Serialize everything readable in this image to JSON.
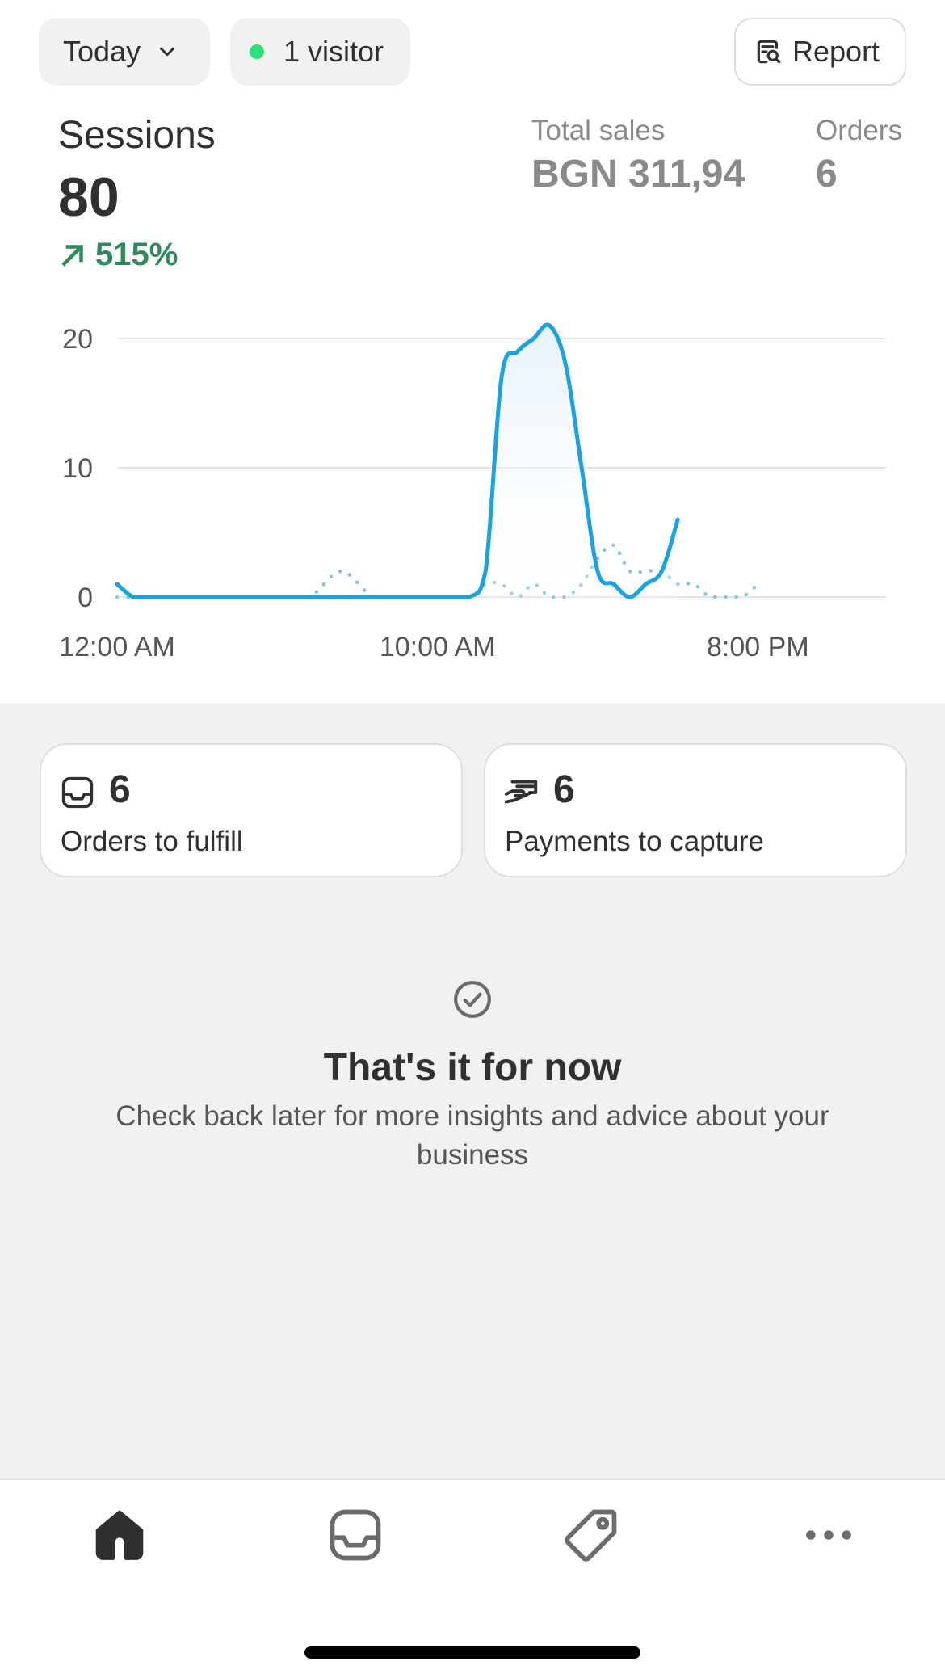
{
  "filters": {
    "date_range": "Today",
    "visitors": "1 visitor",
    "report_label": "Report"
  },
  "metrics": {
    "sessions": {
      "label": "Sessions",
      "value": "80",
      "change": "515%"
    },
    "total_sales": {
      "label": "Total sales",
      "value": "BGN 311,94"
    },
    "orders": {
      "label": "Orders",
      "value": "6"
    }
  },
  "chart_data": {
    "type": "line",
    "title": "",
    "xlabel": "",
    "ylabel": "",
    "ylim": [
      0,
      20
    ],
    "y_ticks": [
      "0",
      "10",
      "20"
    ],
    "x_tick_labels": [
      "12:00 AM",
      "10:00 AM",
      "8:00 PM"
    ],
    "grid": true,
    "x_hours": [
      0,
      0.5,
      1,
      2,
      3,
      4,
      5,
      6,
      7,
      8,
      9,
      10,
      11,
      11.5,
      12,
      12.5,
      13,
      13.5,
      14,
      14.5,
      15,
      15.5,
      16,
      16.5,
      17,
      17.5,
      18,
      18.5,
      19,
      19.5,
      20
    ],
    "series": [
      {
        "name": "",
        "style": "solid",
        "color": "#1aa3e0",
        "values": [
          1,
          0,
          0,
          0,
          0,
          0,
          0,
          0,
          0,
          0,
          0,
          0,
          0,
          2,
          17,
          19,
          20,
          21,
          18,
          10,
          2,
          1,
          0,
          1,
          2,
          6,
          null,
          null,
          null,
          null,
          null
        ]
      },
      {
        "name": "",
        "style": "dotted",
        "color": "#7cc6e8",
        "values": [
          0,
          0,
          0,
          0,
          0,
          0,
          0,
          0,
          2,
          0,
          0,
          0,
          0,
          1,
          1,
          0,
          1,
          0,
          0,
          1,
          3,
          4,
          2,
          2,
          2,
          1,
          1,
          0,
          0,
          0,
          1
        ]
      }
    ]
  },
  "tasks": {
    "orders_to_fulfill": {
      "count": "6",
      "label": "Orders to fulfill"
    },
    "payments_to_capture": {
      "count": "6",
      "label": "Payments to capture"
    }
  },
  "empty_state": {
    "title": "That's it for now",
    "body": "Check back later for more insights and advice about your business"
  },
  "nav": {
    "items": [
      "home-icon",
      "orders-icon",
      "products-icon",
      "more-icon"
    ],
    "active": "home"
  },
  "colors": {
    "accent_line": "#1aa3e0",
    "positive": "#2e8a5a",
    "live_dot": "#29e07a"
  }
}
